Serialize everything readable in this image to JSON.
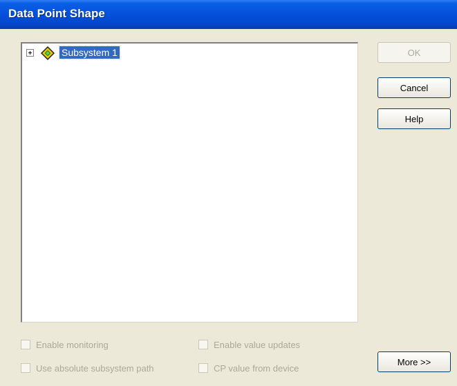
{
  "window": {
    "title": "Data Point Shape"
  },
  "tree": {
    "nodes": [
      {
        "label": "Subsystem 1",
        "icon": "subsystem-diamond-icon",
        "expanded": false,
        "selected": true
      }
    ]
  },
  "buttons": {
    "ok": "OK",
    "cancel": "Cancel",
    "help": "Help",
    "more": "More >>"
  },
  "options": {
    "enable_monitoring": "Enable monitoring",
    "use_absolute_path": "Use absolute subsystem path",
    "enable_value_updates": "Enable value updates",
    "cp_value_from_device": "CP value from device"
  },
  "colors": {
    "titlebar": "#0550dc",
    "selection": "#316ac5",
    "dialog_bg": "#ece9d8",
    "disabled_text": "#aca899"
  }
}
